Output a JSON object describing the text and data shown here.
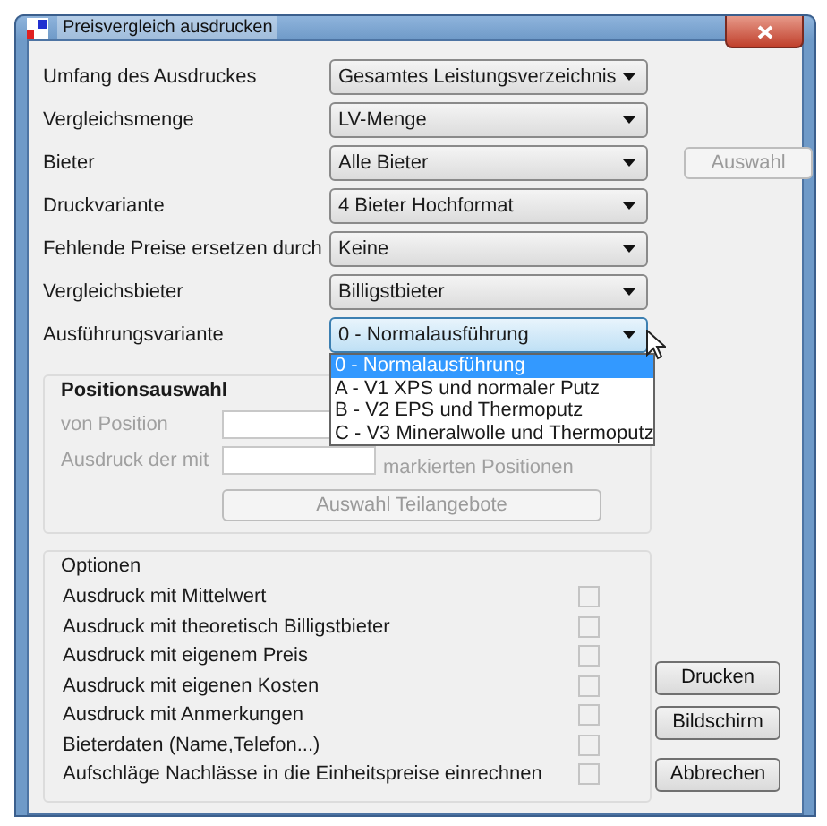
{
  "window": {
    "title": "Preisvergleich ausdrucken"
  },
  "fields": [
    {
      "label": "Umfang des Ausdruckes",
      "value": "Gesamtes Leistungsverzeichnis",
      "focused": false
    },
    {
      "label": "Vergleichsmenge",
      "value": "LV-Menge",
      "focused": false
    },
    {
      "label": "Bieter",
      "value": "Alle Bieter",
      "focused": false,
      "side_button": {
        "label": "Auswahl",
        "disabled": true
      }
    },
    {
      "label": "Druckvariante",
      "value": "4 Bieter Hochformat",
      "focused": false
    },
    {
      "label": "Fehlende Preise ersetzen durch",
      "value": "Keine",
      "focused": false
    },
    {
      "label": "Vergleichsbieter",
      "value": "Billigstbieter",
      "focused": false
    },
    {
      "label": "Ausführungsvariante",
      "value": "0 - Normalausführung",
      "focused": true,
      "options": [
        {
          "label": "0 - Normalausführung",
          "selected": true
        },
        {
          "label": "A - V1 XPS und normaler Putz",
          "selected": false
        },
        {
          "label": "B - V2 EPS und Thermoputz",
          "selected": false
        },
        {
          "label": "C - V3 Mineralwolle und Thermoputz",
          "selected": false
        }
      ]
    }
  ],
  "position_group": {
    "title": "Positionsauswahl",
    "disabled": true,
    "rows": [
      {
        "label": "von Position"
      },
      {
        "label": "Ausdruck der mit",
        "after": "markierten Positionen"
      }
    ],
    "button": {
      "label": "Auswahl Teilangebote",
      "disabled": true
    }
  },
  "options_group": {
    "title": "Optionen",
    "items": [
      {
        "label": "Ausdruck mit Mittelwert",
        "checked": false,
        "disabled": true
      },
      {
        "label": "Ausdruck mit theoretisch Billigstbieter",
        "checked": false,
        "disabled": true
      },
      {
        "label": "Ausdruck mit eigenem Preis",
        "checked": false,
        "disabled": true
      },
      {
        "label": "Ausdruck mit eigenen Kosten",
        "checked": false,
        "disabled": true
      },
      {
        "label": "Ausdruck mit Anmerkungen",
        "checked": false,
        "disabled": true
      },
      {
        "label": "Bieterdaten (Name,Telefon...)",
        "checked": false,
        "disabled": true
      },
      {
        "label": "Aufschläge Nachlässe in die Einheitspreise einrechnen",
        "checked": false,
        "disabled": true
      }
    ]
  },
  "buttons": [
    "Drucken",
    "Bildschirm",
    "Abbrechen"
  ]
}
